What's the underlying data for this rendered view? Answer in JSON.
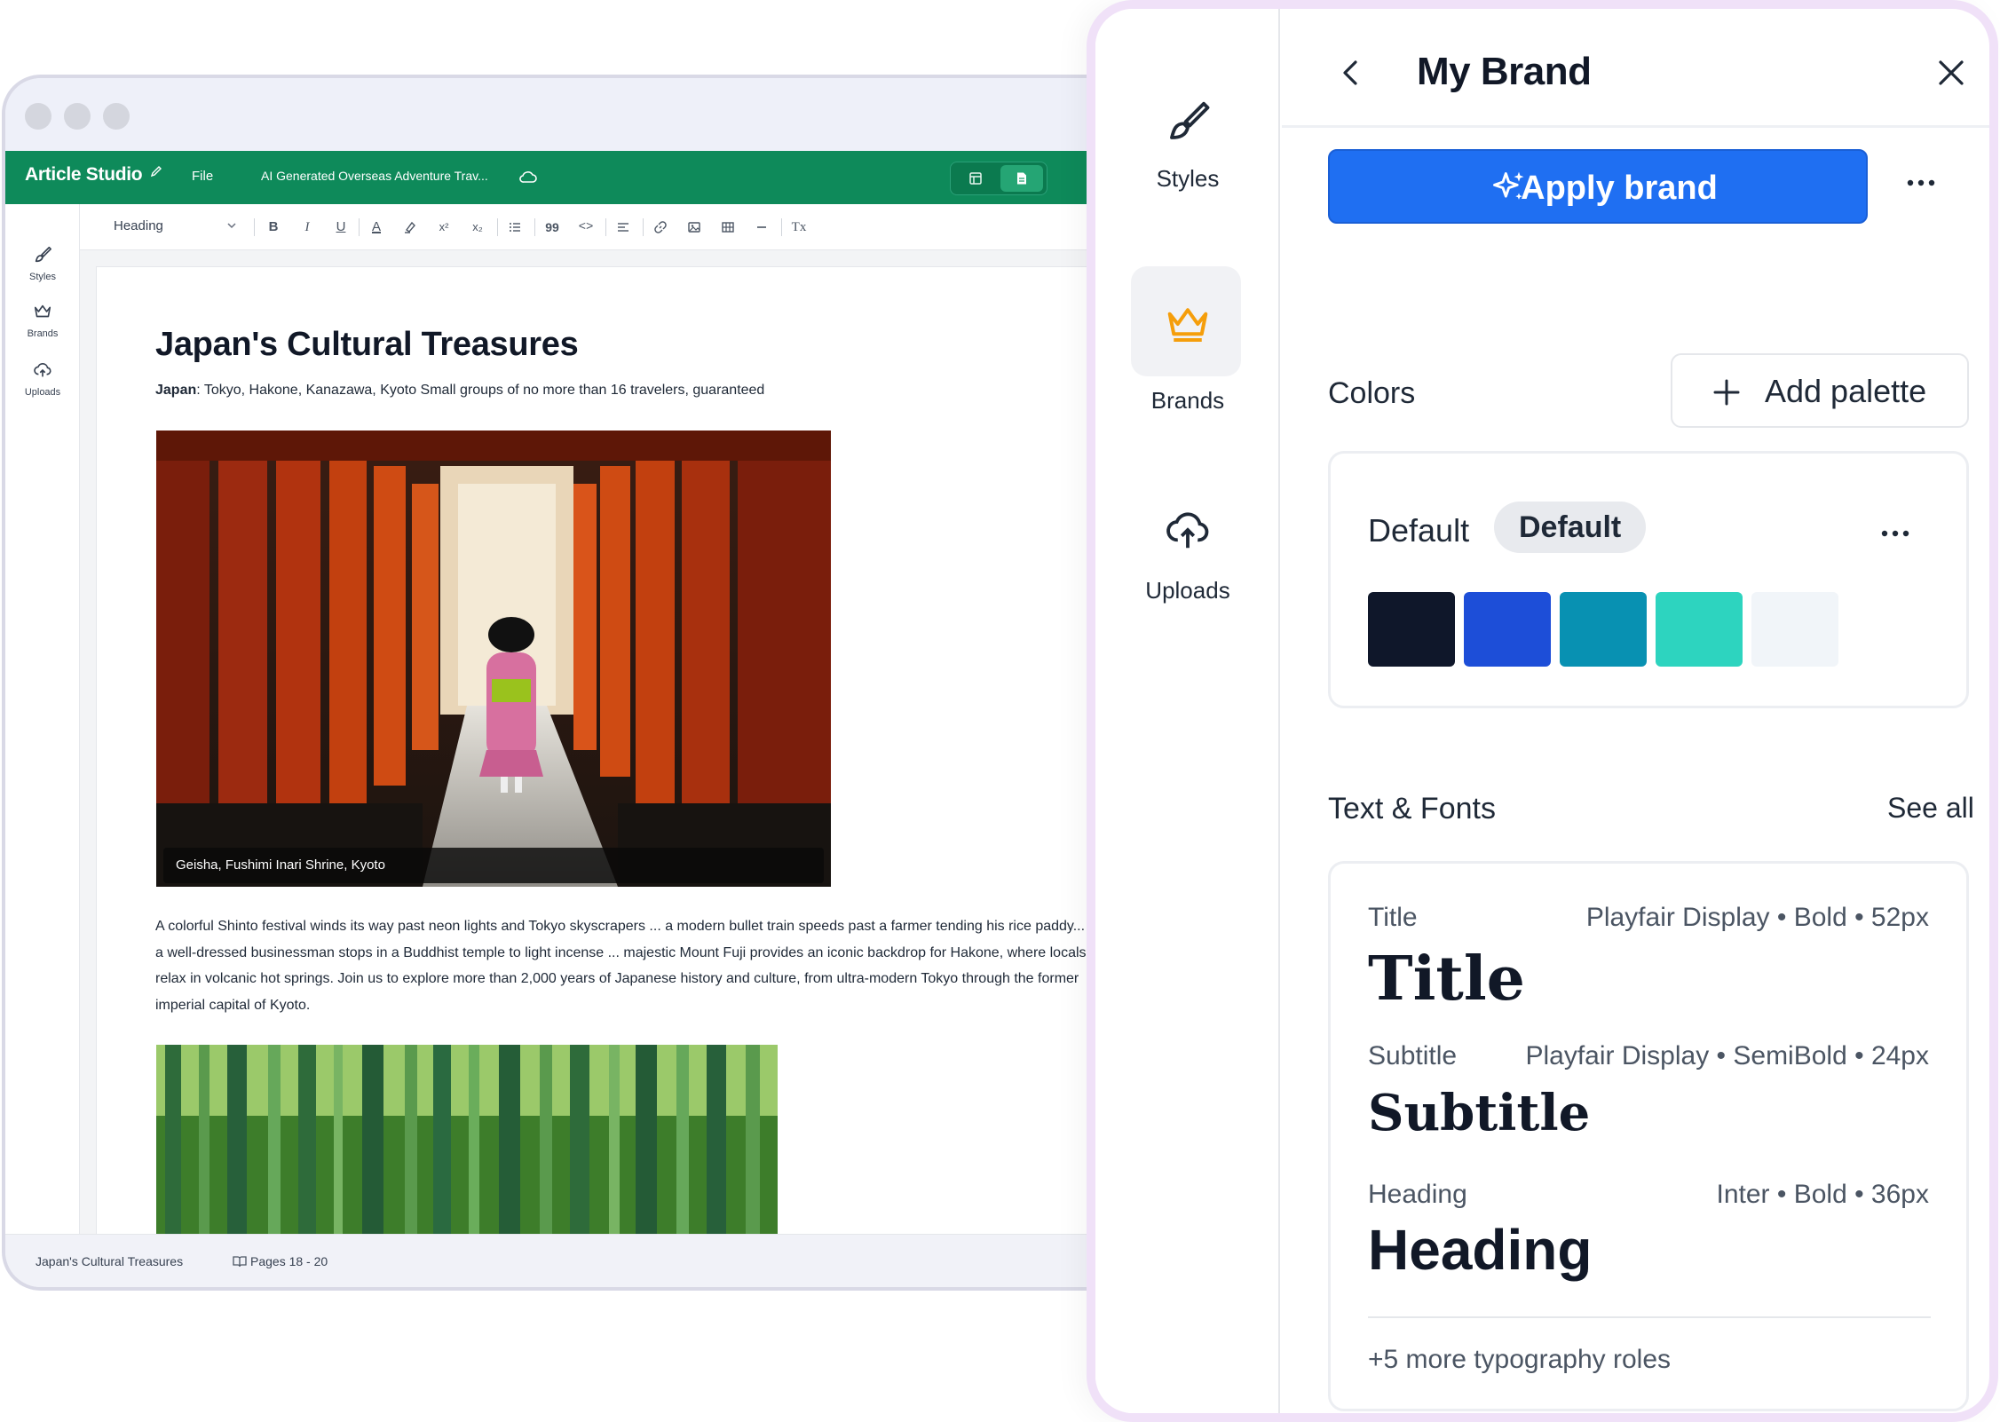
{
  "editor": {
    "app_title": "Article Studio",
    "file_menu": "File",
    "document_name": "AI Generated Overseas Adventure Trav...",
    "left_rail": [
      {
        "label": "Styles",
        "icon": "paintbrush-icon"
      },
      {
        "label": "Brands",
        "icon": "crown-icon"
      },
      {
        "label": "Uploads",
        "icon": "cloud-upload-icon"
      }
    ],
    "toolbar": {
      "block_style": "Heading",
      "bold": "B",
      "italic": "I",
      "underline": "U",
      "text_color": "A",
      "superscript": "x²",
      "subscript": "x₂",
      "quote": "99",
      "code": "<>",
      "clear_format": "Tx"
    },
    "document": {
      "title": "Japan's Cultural Treasures",
      "subtitle_bold": "Japan",
      "subtitle_rest": ": Tokyo, Hakone, Kanazawa, Kyoto Small groups of no more than 16 travelers, guaranteed",
      "photo_caption": "Geisha, Fushimi Inari Shrine, Kyoto",
      "body": "A colorful Shinto festival winds its way past neon lights and Tokyo skyscrapers ... a modern bullet train speeds past a farmer tending his rice paddy... a well-dressed businessman stops in a Buddhist temple to light incense ... majestic Mount Fuji provides an iconic backdrop for Hakone, where locals relax in volcanic hot springs. Join us to explore more than 2,000 years of Japanese history and culture, from ultra-modern Tokyo through the former imperial capital of Kyoto."
    },
    "status": {
      "doc_title": "Japan's Cultural Treasures",
      "pages": "Pages 18 - 20"
    },
    "colors": {
      "accent": "#0e8a5a"
    }
  },
  "panel": {
    "rail": [
      {
        "label": "Styles",
        "icon": "paintbrush-icon"
      },
      {
        "label": "Brands",
        "icon": "crown-icon"
      },
      {
        "label": "Uploads",
        "icon": "cloud-upload-icon"
      }
    ],
    "title": "My Brand",
    "apply_button": "Apply brand",
    "colors_heading": "Colors",
    "add_palette": "Add palette",
    "palette": {
      "name": "Default",
      "badge": "Default",
      "swatches": [
        "#0f172a",
        "#1d4ed8",
        "#0891b2",
        "#2dd4bf",
        "#f1f5f9"
      ]
    },
    "text_fonts_heading": "Text & Fonts",
    "see_all": "See all",
    "typography": [
      {
        "role": "Title",
        "spec": "Playfair Display • Bold • 52px",
        "sample": "Title"
      },
      {
        "role": "Subtitle",
        "spec": "Playfair Display • SemiBold • 24px",
        "sample": "Subtitle"
      },
      {
        "role": "Heading",
        "spec": "Inter • Bold • 36px",
        "sample": "Heading"
      }
    ],
    "more_roles": "+5 more typography roles",
    "colors": {
      "primary": "#1f6ff2",
      "brand_icon": "#f59e0b"
    }
  }
}
